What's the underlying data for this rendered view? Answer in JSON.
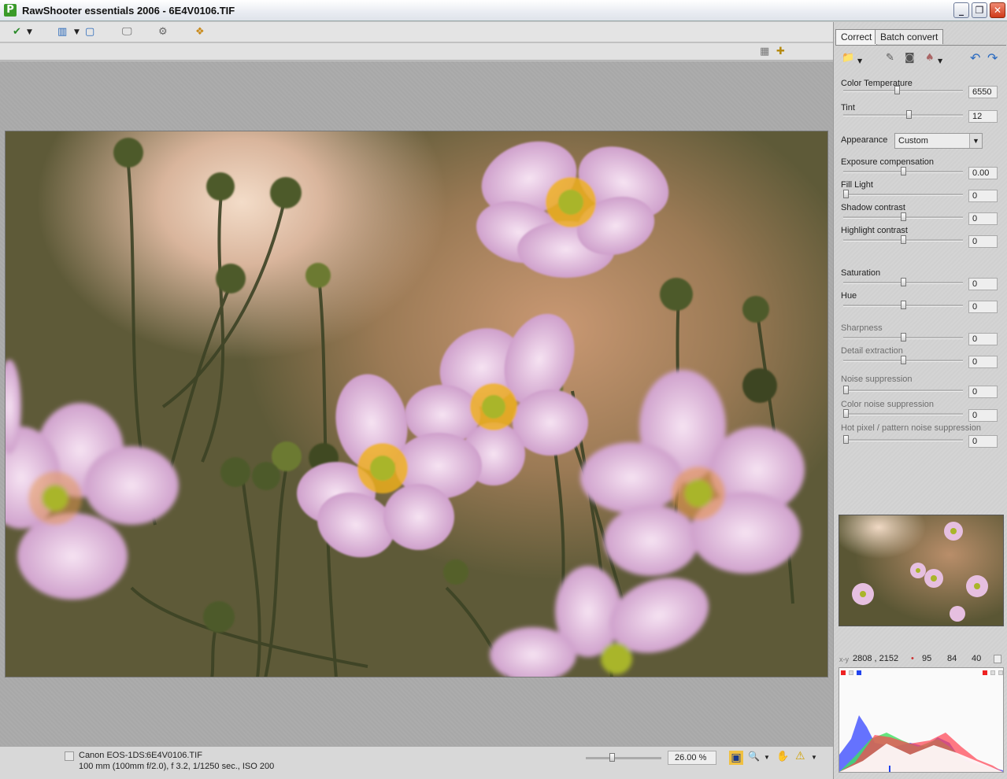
{
  "window": {
    "title": "RawShooter essentials 2006 - 6E4V0106.TIF"
  },
  "tabs": [
    {
      "label": "Correct"
    },
    {
      "label": "Batch convert"
    }
  ],
  "controls": {
    "color_temperature": {
      "label": "Color Temperature",
      "value": "6550",
      "level": 0.45
    },
    "tint": {
      "label": "Tint",
      "value": "12",
      "level": 0.55
    },
    "appearance": {
      "label": "Appearance",
      "value": "Custom"
    },
    "exposure": {
      "label": "Exposure compensation",
      "value": "0.00",
      "level": 0.5
    },
    "fill_light": {
      "label": "Fill Light",
      "value": "0",
      "level": 0.0
    },
    "shadow_contrast": {
      "label": "Shadow contrast",
      "value": "0",
      "level": 0.5
    },
    "highlight_contrast": {
      "label": "Highlight contrast",
      "value": "0",
      "level": 0.5
    },
    "saturation": {
      "label": "Saturation",
      "value": "0",
      "level": 0.5
    },
    "hue": {
      "label": "Hue",
      "value": "0",
      "level": 0.5
    },
    "sharpness": {
      "label": "Sharpness",
      "value": "0",
      "level": 0.5
    },
    "detail_extraction": {
      "label": "Detail extraction",
      "value": "0",
      "level": 0.5
    },
    "noise_suppression": {
      "label": "Noise suppression",
      "value": "0",
      "level": 0.0
    },
    "color_noise": {
      "label": "Color noise suppression",
      "value": "0",
      "level": 0.0
    },
    "hot_pixel": {
      "label": "Hot pixel / pattern noise suppression",
      "value": "0",
      "level": 0.0
    }
  },
  "readout": {
    "xy_label": "x-y",
    "xy": "2808 , 2152",
    "r": "95",
    "g": "84",
    "b": "40"
  },
  "status": {
    "camera": "Canon EOS-1DS:",
    "file": "6E4V0106.TIF",
    "exposure_info": "100 mm (100mm f/2.0), f 3.2, 1/1250 sec., ISO 200",
    "zoom": "26.00 %",
    "zoom_level": 0.25
  },
  "icons": {
    "check": "✔",
    "layout": "▥",
    "single": "▢",
    "monitor": "🖵",
    "gears": "⚙",
    "film": "❖",
    "trash": "▦",
    "add": "✚",
    "folder": "📁",
    "eyedropper": "✎",
    "camera": "◙",
    "brush": "♠",
    "undo": "↶",
    "redo": "↷",
    "fit": "▣",
    "zoom": "🔍",
    "hand": "✋",
    "warning": "⚠"
  },
  "colors": {
    "accent": "#3a9a2a",
    "petal": "#e6bfe0",
    "stamen": "#f0b21c",
    "bud": "#5a6b2e"
  }
}
